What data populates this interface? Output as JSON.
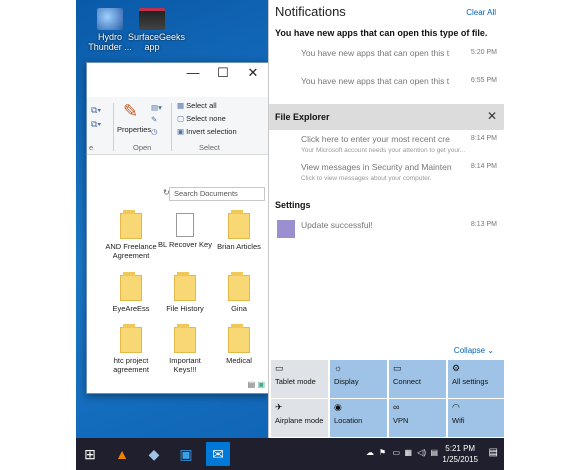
{
  "desktop": {
    "icons": [
      {
        "label": "Hydro Thunder ...",
        "icon": "game-icon"
      },
      {
        "label": "SurfaceGeeks app",
        "icon": "app-icon"
      }
    ]
  },
  "explorer": {
    "ribbon": {
      "properties": "Properties",
      "open_group": "Open",
      "select_group": "Select",
      "select_all": "Select all",
      "select_none": "Select none",
      "invert_selection": "Invert selection",
      "partial_group": "e"
    },
    "search_placeholder": "Search Documents",
    "files": [
      {
        "label": "AND Freelance Agreement",
        "type": "folder"
      },
      {
        "label": "BL Recover Key",
        "type": "doc"
      },
      {
        "label": "Brian Articles",
        "type": "folder"
      },
      {
        "label": "EyeAreEss",
        "type": "folder"
      },
      {
        "label": "File History",
        "type": "folder"
      },
      {
        "label": "Gina",
        "type": "folder"
      },
      {
        "label": "htc project agreement",
        "type": "folder"
      },
      {
        "label": "Important Keys!!!",
        "type": "folder"
      },
      {
        "label": "Medical",
        "type": "folder"
      }
    ]
  },
  "action_center": {
    "title": "Notifications",
    "clear_all": "Clear All",
    "store_heading": "You have new apps that can open this type of file.",
    "store_items": [
      {
        "text": "You have new apps that can open this t",
        "time": "5:20 PM"
      },
      {
        "text": "You have new apps that can open this t",
        "time": "6:55 PM"
      }
    ],
    "fe_heading": "File Explorer",
    "fe_items": [
      {
        "text": "Click here to enter your most recent cre",
        "sub": "Your Microsoft account needs your attention to get your...",
        "time": "8:14 PM"
      },
      {
        "text": "View messages in Security and Mainten",
        "sub": "Click to view messages about your computer.",
        "time": "8:14 PM"
      }
    ],
    "settings_heading": "Settings",
    "settings_items": [
      {
        "text": "Update successful!",
        "time": "8:13 PM"
      }
    ],
    "collapse": "Collapse",
    "quick_actions": [
      {
        "label": "Tablet mode",
        "icon": "tablet-icon",
        "active": false
      },
      {
        "label": "Display",
        "icon": "brightness-icon",
        "active": true
      },
      {
        "label": "Connect",
        "icon": "connect-icon",
        "active": true
      },
      {
        "label": "All settings",
        "icon": "gear-icon",
        "active": true
      },
      {
        "label": "Airplane mode",
        "icon": "airplane-icon",
        "active": false
      },
      {
        "label": "Location",
        "icon": "location-icon",
        "active": true
      },
      {
        "label": "VPN",
        "icon": "vpn-icon",
        "active": true
      },
      {
        "label": "Wifi",
        "icon": "wifi-icon",
        "active": true
      }
    ]
  },
  "taskbar": {
    "time": "5:21 PM",
    "date": "1/25/2015"
  }
}
